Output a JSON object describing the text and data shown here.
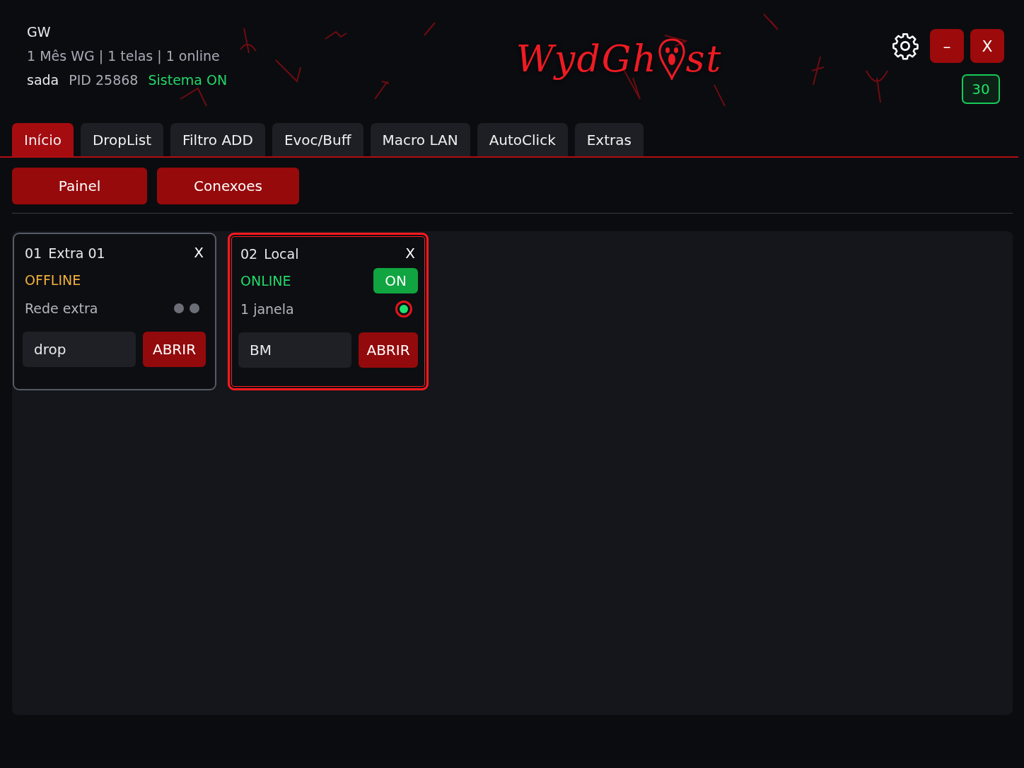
{
  "account": {
    "name": "GW",
    "plan": "1 Mês WG | 1 telas | 1 online",
    "user": "sada",
    "pid": "PID 25868",
    "system": "Sistema ON"
  },
  "logo": {
    "before": "WydGh",
    "after": "st"
  },
  "window_controls": {
    "minimize": "–",
    "close": "X",
    "counter": "30"
  },
  "tabs": [
    {
      "label": "Início",
      "selected": true
    },
    {
      "label": "DropList",
      "selected": false
    },
    {
      "label": "Filtro ADD",
      "selected": false
    },
    {
      "label": "Evoc/Buff",
      "selected": false
    },
    {
      "label": "Macro LAN",
      "selected": false
    },
    {
      "label": "AutoClick",
      "selected": false
    },
    {
      "label": "Extras",
      "selected": false
    }
  ],
  "subtabs": [
    "Painel",
    "Conexoes"
  ],
  "cards": [
    {
      "number": "01",
      "name": "Extra 01",
      "close": "X",
      "status": "OFFLINE",
      "online": false,
      "selected": false,
      "detail": "Rede extra",
      "indicator": {
        "kind": "dots"
      },
      "field": "drop",
      "button": "ABRIR"
    },
    {
      "number": "02",
      "name": "Local",
      "close": "X",
      "status": "ONLINE",
      "online": true,
      "selected": true,
      "toggle": "ON",
      "detail": "1 janela",
      "indicator": {
        "kind": "radio"
      },
      "field": "BM",
      "button": "ABRIR"
    }
  ]
}
